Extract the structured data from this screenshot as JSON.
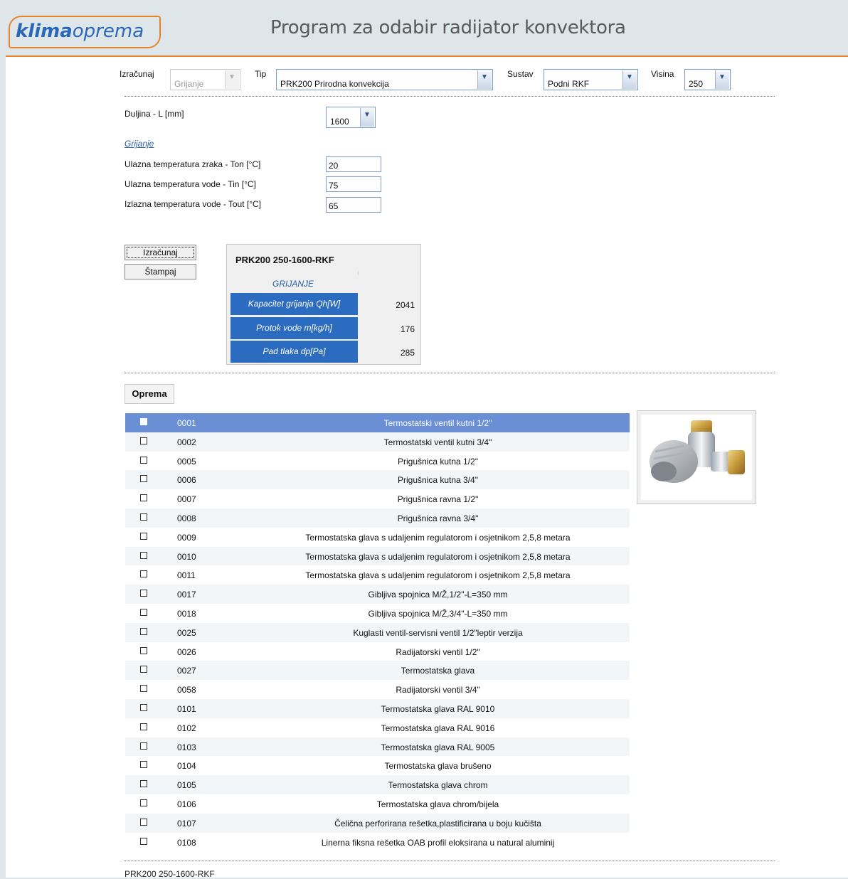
{
  "header": {
    "logo_part1": "klima",
    "logo_part2": "oprema",
    "title": "Program za odabir radijator konvektora"
  },
  "filters": {
    "izracunaj_label": "Izračunaj",
    "izracunaj_value": "Grijanje",
    "tip_label": "Tip",
    "tip_value": "PRK200 Prirodna konvekcija",
    "sustav_label": "Sustav",
    "sustav_value": "Podni RKF",
    "visina_label": "Visina",
    "visina_value": "250"
  },
  "duljina": {
    "label": "Duljina - L [mm]",
    "value": "1600"
  },
  "grijanje_link": "Grijanje",
  "inputs": {
    "ton_label": "Ulazna temperatura zraka - Ton [°C]",
    "ton_value": "20",
    "tin_label": "Ulazna temperatura vode - Tin [°C]",
    "tin_value": "75",
    "tout_label": "Izlazna temperatura vode - Tout [°C]",
    "tout_value": "65"
  },
  "buttons": {
    "izracunaj": "Izračunaj",
    "stampaj": "Štampaj"
  },
  "result": {
    "title": "PRK200 250-1600-RKF",
    "subtitle": "GRIJANJE",
    "rows": [
      {
        "label": "Kapacitet grijanja Qh[W]",
        "value": "2041"
      },
      {
        "label": "Protok vode m[kg/h]",
        "value": "176"
      },
      {
        "label": "Pad tlaka dp[Pa]",
        "value": "285"
      }
    ]
  },
  "oprema_button": "Oprema",
  "equipment": [
    {
      "code": "0001",
      "desc": "Termostatski ventil kutni 1/2\"",
      "selected": true
    },
    {
      "code": "0002",
      "desc": "Termostatski ventil kutni 3/4\""
    },
    {
      "code": "0005",
      "desc": "Prigušnica kutna 1/2\""
    },
    {
      "code": "0006",
      "desc": "Prigušnica kutna 3/4\""
    },
    {
      "code": "0007",
      "desc": "Prigušnica ravna 1/2\""
    },
    {
      "code": "0008",
      "desc": "Prigušnica ravna 3/4\""
    },
    {
      "code": "0009",
      "desc": "Termostatska glava s udaljenim regulatorom i osjetnikom 2,5,8 metara"
    },
    {
      "code": "0010",
      "desc": "Termostatska glava s udaljenim regulatorom i osjetnikom 2,5,8 metara"
    },
    {
      "code": "0011",
      "desc": "Termostatska glava s udaljenim regulatorom i osjetnikom 2,5,8 metara"
    },
    {
      "code": "0017",
      "desc": "Gibljiva spojnica M/Ž,1/2\"-L=350 mm"
    },
    {
      "code": "0018",
      "desc": "Gibljiva spojnica M/Ž,3/4\"-L=350 mm"
    },
    {
      "code": "0025",
      "desc": "Kuglasti ventil-servisni ventil 1/2\"leptir verzija"
    },
    {
      "code": "0026",
      "desc": "Radijatorski ventil 1/2\""
    },
    {
      "code": "0027",
      "desc": "Termostatska glava"
    },
    {
      "code": "0058",
      "desc": "Radijatorski ventil 3/4\""
    },
    {
      "code": "0101",
      "desc": "Termostatska glava RAL 9010"
    },
    {
      "code": "0102",
      "desc": "Termostatska glava RAL 9016"
    },
    {
      "code": "0103",
      "desc": "Termostatska glava RAL 9005"
    },
    {
      "code": "0104",
      "desc": "Termostatska glava brušeno"
    },
    {
      "code": "0105",
      "desc": "Termostatska glava chrom"
    },
    {
      "code": "0106",
      "desc": "Termostatska glava chrom/bijela"
    },
    {
      "code": "0107",
      "desc": "Čelična perforirana rešetka,plastificirana u boju kučišta"
    },
    {
      "code": "0108",
      "desc": "Linerna fiksna rešetka OAB profil eloksirana u natural aluminij"
    }
  ],
  "footer_text": "PRK200 250-1600-RKF",
  "colors": {
    "accent": "#e6842c",
    "brand_blue": "#2b6cc1",
    "selected_row": "#6b8fd4"
  },
  "icons": {
    "dropdown": "chevron-down-icon",
    "checkbox": "checkbox-icon",
    "product_photo": "thermostatic-valve-image"
  }
}
